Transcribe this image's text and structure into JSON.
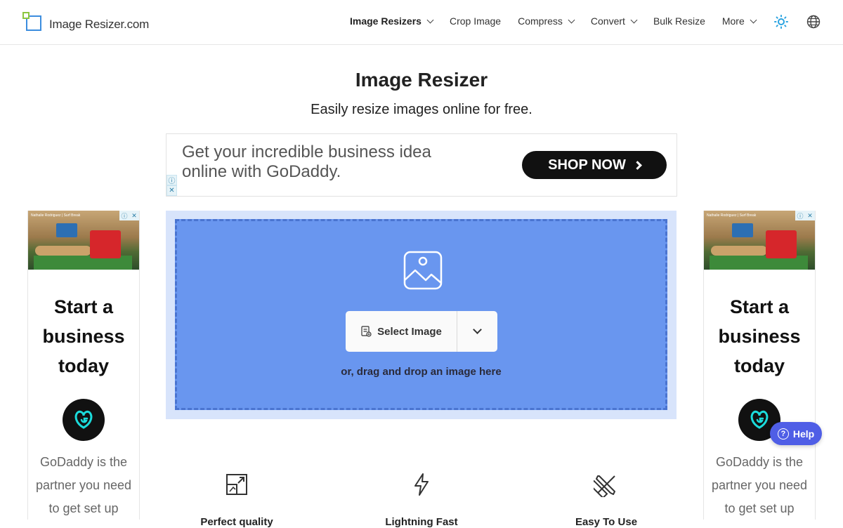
{
  "logo": {
    "text": "Image Resizer.com"
  },
  "nav": {
    "items": [
      {
        "label": "Image Resizers",
        "dropdown": true,
        "active": true
      },
      {
        "label": "Crop Image",
        "dropdown": false
      },
      {
        "label": "Compress",
        "dropdown": true
      },
      {
        "label": "Convert",
        "dropdown": true
      },
      {
        "label": "Bulk Resize",
        "dropdown": false
      },
      {
        "label": "More",
        "dropdown": true
      }
    ],
    "theme_icon": "sun-icon",
    "language_icon": "globe-icon"
  },
  "hero": {
    "title": "Image Resizer",
    "subtitle": "Easily resize images online for free."
  },
  "top_ad": {
    "text_line1": "Get your incredible business idea",
    "text_line2": "online with GoDaddy.",
    "button": "SHOP NOW"
  },
  "side_ad": {
    "caption": "Nathalie Rodriguez | Surf Break",
    "headline_line1": "Start a",
    "headline_line2": "business",
    "headline_line3": "today",
    "copy_line1": "GoDaddy is the",
    "copy_line2": "partner you need",
    "copy_line3": "to get set up"
  },
  "upload": {
    "select_label": "Select Image",
    "drag_text": "or, drag and drop an image here"
  },
  "features": [
    {
      "label": "Perfect quality",
      "icon": "resize-icon"
    },
    {
      "label": "Lightning Fast",
      "icon": "lightning-icon"
    },
    {
      "label": "Easy To Use",
      "icon": "tools-icon"
    }
  ],
  "help": {
    "label": "Help"
  },
  "colors": {
    "upload_bg": "#6996ef",
    "upload_outer": "#d8e4fb",
    "help_bg": "#4f5ee6",
    "theme_icon": "#2aa3e0"
  }
}
